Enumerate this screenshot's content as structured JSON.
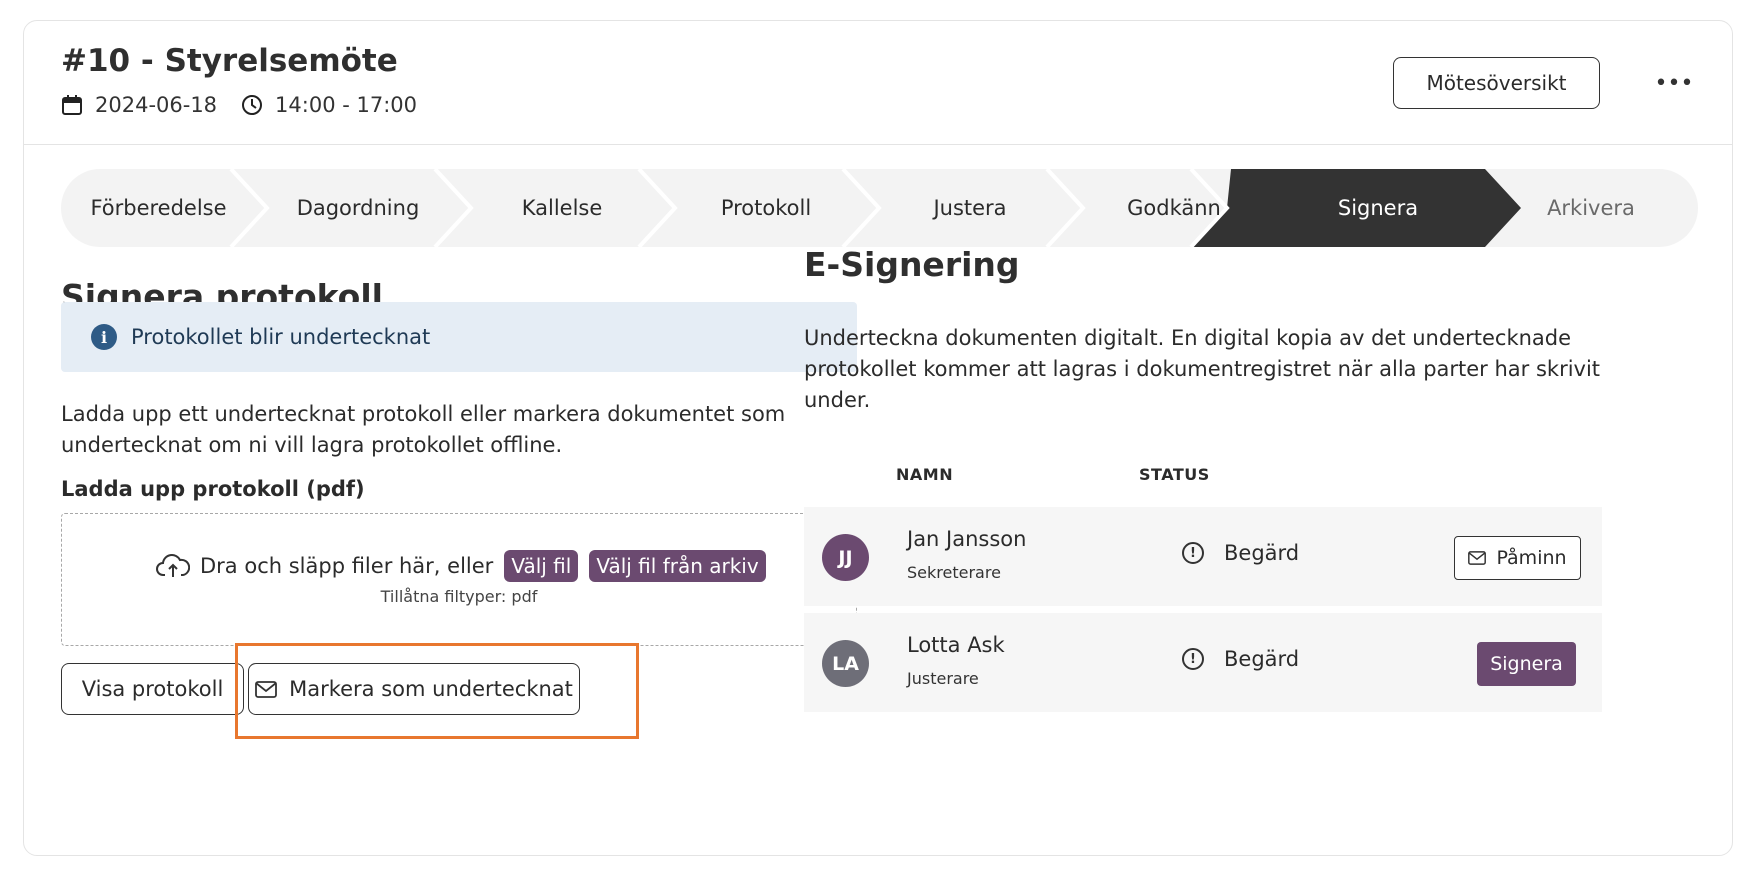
{
  "header": {
    "title": "#10 - Styrelsemöte",
    "date": "2024-06-18",
    "time": "14:00 - 17:00",
    "overview_button": "Mötesöversikt",
    "more_button": "•••"
  },
  "stepper": {
    "steps": [
      {
        "label": "Förberedelse",
        "state": "done"
      },
      {
        "label": "Dagordning",
        "state": "done"
      },
      {
        "label": "Kallelse",
        "state": "done"
      },
      {
        "label": "Protokoll",
        "state": "done"
      },
      {
        "label": "Justera",
        "state": "done"
      },
      {
        "label": "Godkänn",
        "state": "done"
      },
      {
        "label": "Signera",
        "state": "active"
      },
      {
        "label": "Arkivera",
        "state": "upcoming"
      }
    ]
  },
  "left": {
    "heading": "Signera protokoll",
    "info_text": "Protokollet blir undertecknat",
    "description_line1": "Ladda upp ett undertecknat protokoll eller markera dokumentet som",
    "description_line2": "undertecknat om ni vill lagra protokollet offline.",
    "upload_label": "Ladda upp protokoll (pdf)",
    "drop_text": "Dra och släpp filer här, eller",
    "choose_file": "Välj fil",
    "choose_archive": "Välj fil från arkiv",
    "allowed_types": "Tillåtna filtyper: pdf",
    "show_button": "Visa protokoll",
    "mark_signed_button": "Markera som undertecknat"
  },
  "right": {
    "heading": "E-Signering",
    "description_line1": "Underteckna dokumenten digitalt. En digital kopia av det undertecknade",
    "description_line2": "protokollet kommer att lagras i dokumentregistret när alla parter har skrivit",
    "description_line3": "under.",
    "col_name": "NAMN",
    "col_status": "STATUS",
    "signers": [
      {
        "initials": "JJ",
        "name": "Jan Jansson",
        "role": "Sekreterare",
        "status": "Begärd",
        "action": "Påminn"
      },
      {
        "initials": "LA",
        "name": "Lotta Ask",
        "role": "Justerare",
        "status": "Begärd",
        "action": "Signera"
      }
    ]
  },
  "colors": {
    "accent_purple": "#6b4a70",
    "active_step": "#333333",
    "info_bg": "#e5edf5",
    "highlight_orange": "#e8772e",
    "avatar_lotta": "#6e6e78"
  },
  "icons": [
    "calendar-icon",
    "clock-icon",
    "more-icon",
    "info-icon",
    "cloud-upload-icon",
    "envelope-icon",
    "exclamation-circle-icon"
  ]
}
